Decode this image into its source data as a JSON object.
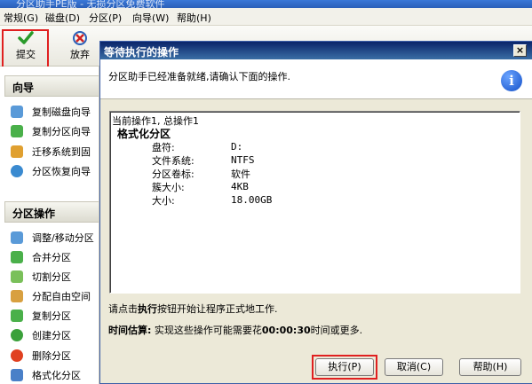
{
  "app": {
    "title": "分区助手PE版 - 无损分区免费软件",
    "menu": [
      "常规(G)",
      "磁盘(D)",
      "分区(P)",
      "向导(W)",
      "帮助(H)"
    ],
    "toolbar": {
      "submit_label": "提交",
      "discard_label": "放弃"
    }
  },
  "sidebar": {
    "wizard_title": "向导",
    "wizard_items": [
      "复制磁盘向导",
      "复制分区向导",
      "迁移系统到固",
      "分区恢复向导"
    ],
    "ops_title": "分区操作",
    "ops_items": [
      "调整/移动分区",
      "合并分区",
      "切割分区",
      "分配自由空间",
      "复制分区",
      "创建分区",
      "删除分区",
      "格式化分区"
    ]
  },
  "dialog": {
    "title": "等待执行的操作",
    "close_glyph": "×",
    "header_msg": "分区助手已经准备就绪,请确认下面的操作.",
    "info_glyph": "i",
    "ops": {
      "summary": "当前操作1, 总操作1",
      "op_title": "格式化分区",
      "fields": [
        {
          "label": "盘符:",
          "value": "D:"
        },
        {
          "label": "文件系统:",
          "value": "NTFS"
        },
        {
          "label": "分区卷标:",
          "value": "软件"
        },
        {
          "label": "簇大小:",
          "value": "4KB"
        },
        {
          "label": "大小:",
          "value": "18.00GB"
        }
      ]
    },
    "hint_pre": "请点击",
    "hint_bold": "执行",
    "hint_post": "按钮开始让程序正式地工作.",
    "estimate_label": "时间估算:",
    "estimate_pre": " 实现这些操作可能需要花",
    "estimate_time": "00:00:30",
    "estimate_post": "时间或更多.",
    "buttons": {
      "execute": "执行(P)",
      "cancel": "取消(C)",
      "help": "帮助(H)"
    }
  },
  "colors": {
    "highlight": "#e02020",
    "title_bar": "#0a246a"
  }
}
